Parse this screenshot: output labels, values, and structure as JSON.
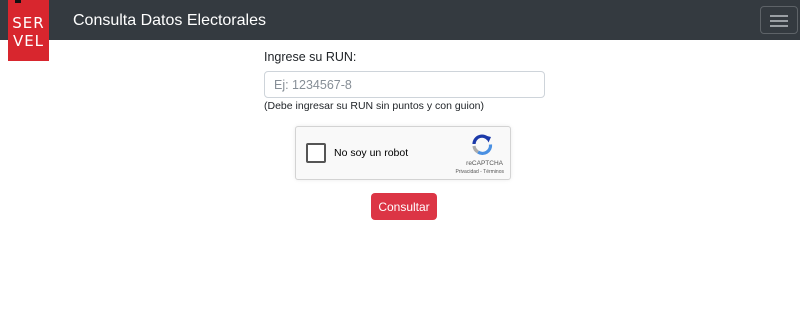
{
  "navbar": {
    "logo": {
      "line1": "SER",
      "line2": "VEL"
    },
    "brand": "Consulta Datos Electorales",
    "menu_icon": "hamburger-icon"
  },
  "form": {
    "run_label": "Ingrese su RUN:",
    "run_input": {
      "value": "",
      "placeholder": "Ej: 1234567-8"
    },
    "help_text": "(Debe ingresar su RUN sin puntos y con guion)",
    "captcha": {
      "label": "No soy un robot",
      "brand": "reCAPTCHA",
      "privacy": "Privacidad",
      "separator": " - ",
      "terms": "Términos",
      "checked": false,
      "icon": "recaptcha-icon"
    },
    "submit_label": "Consultar"
  },
  "colors": {
    "navbar_bg": "#343a40",
    "logo_red": "#d8262e",
    "button_red": "#dc3545"
  }
}
